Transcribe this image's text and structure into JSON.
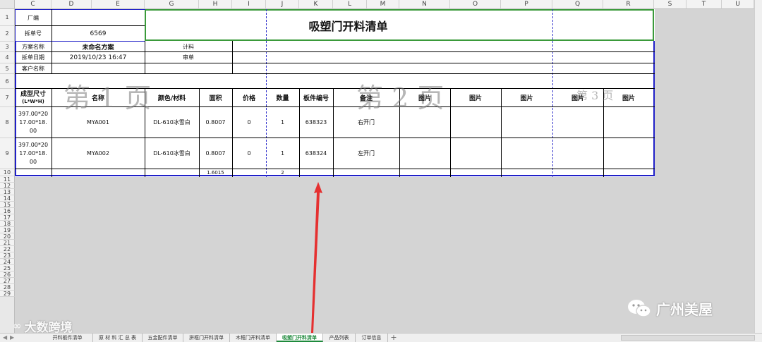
{
  "columns": [
    "C",
    "D",
    "E",
    "G",
    "H",
    "I",
    "J",
    "K",
    "L",
    "M",
    "N",
    "O",
    "P",
    "Q",
    "R",
    "S",
    "T",
    "U"
  ],
  "rows": [
    "1",
    "2",
    "3",
    "4",
    "5",
    "6",
    "7",
    "8",
    "9",
    "10",
    "11",
    "12",
    "13",
    "14",
    "15",
    "16",
    "17",
    "18",
    "19",
    "20",
    "21",
    "22",
    "23",
    "24",
    "25",
    "26",
    "27",
    "28",
    "29"
  ],
  "form": {
    "title": "吸塑门开料清单",
    "factory_label": "厂编",
    "order_no_label": "拆单号",
    "order_no": "6569",
    "scheme_label": "方案名称",
    "scheme_value": "未命名方案",
    "date_label": "拆单日期",
    "date_value": "2019/10/23  16:47",
    "customer_label": "客户名称",
    "calc_label": "计料",
    "review_label": "审单"
  },
  "table": {
    "headers": {
      "size": "成型尺寸",
      "size_sub": "(L*W*H)",
      "name": "名称",
      "color": "颜色/材料",
      "area": "面积",
      "price": "价格",
      "qty": "数量",
      "board": "板件编号",
      "note": "备注",
      "pic1": "图片",
      "pic2": "图片",
      "pic3": "图片",
      "pic4": "图片",
      "pic5": "图片"
    },
    "rows": [
      {
        "size": [
          "397.00*20",
          "17.00*18.",
          "00"
        ],
        "name": "MYA001",
        "color": "DL-610冰雪白",
        "area": "0.8007",
        "price": "0",
        "qty": "1",
        "board": "638323",
        "note": "右开门"
      },
      {
        "size": [
          "397.00*20",
          "17.00*18.",
          "00"
        ],
        "name": "MYA002",
        "color": "DL-610冰雪白",
        "area": "0.8007",
        "price": "0",
        "qty": "1",
        "board": "638324",
        "note": "左开门"
      }
    ],
    "total_area": "1.6015",
    "total_qty": "2"
  },
  "watermarks": {
    "page1": "第 1  页",
    "page2": "第 2 页",
    "page3": "第 3  页"
  },
  "tabs": [
    "开料板件清单",
    "原 材 料 汇 总 表",
    "五金配件清单",
    "拼框门开料清单",
    "木框门开料清单",
    "吸塑门开料清单",
    "产品列表",
    "订单信息"
  ],
  "active_tab": "吸塑门开料清单",
  "overlay": {
    "left_logo": "大数跨境",
    "right_logo": "广州美屋"
  },
  "colors": {
    "arrow": "#e53030",
    "green_border": "#3a9a3a",
    "blue_border": "#2020c8",
    "active_tab": "#1e8a3c"
  }
}
